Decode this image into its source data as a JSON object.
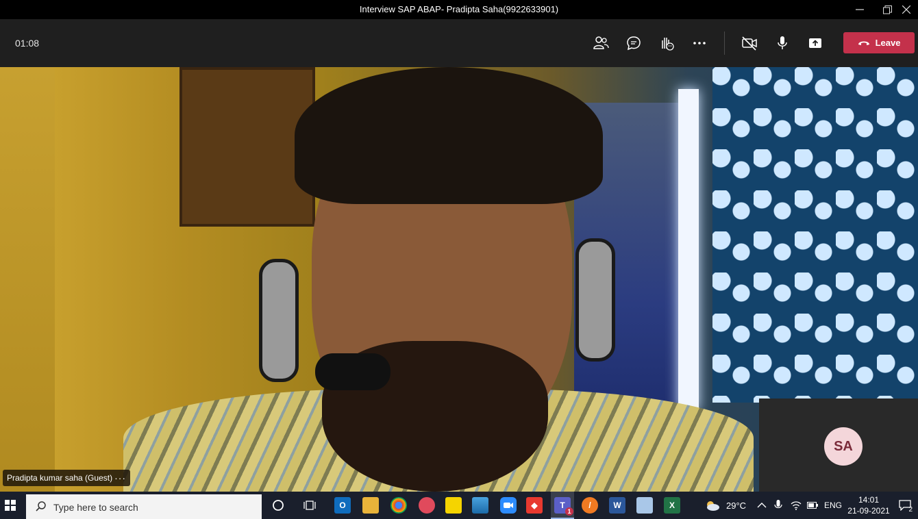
{
  "window": {
    "title": "Interview SAP ABAP- Pradipta Saha(9922633901)"
  },
  "meeting": {
    "timer": "01:08",
    "leave_label": "Leave",
    "toolbar_icons": [
      "participants-icon",
      "chat-icon",
      "raise-hand-icon",
      "more-icon",
      "camera-off-icon",
      "mic-icon",
      "share-icon"
    ]
  },
  "video": {
    "participant_name": "Pradipta kumar saha (Guest)",
    "more_dots": "···",
    "self_avatar_initials": "SA"
  },
  "taskbar": {
    "search_placeholder": "Type here to search",
    "weather": "29°C",
    "language": "ENG",
    "time": "14:01",
    "date": "21-09-2021",
    "teams_badge": "1",
    "notification_count": "2"
  },
  "colors": {
    "leave": "#c4314b",
    "toolbar": "#1f1f1f",
    "taskbar": "#1a1f2c"
  }
}
